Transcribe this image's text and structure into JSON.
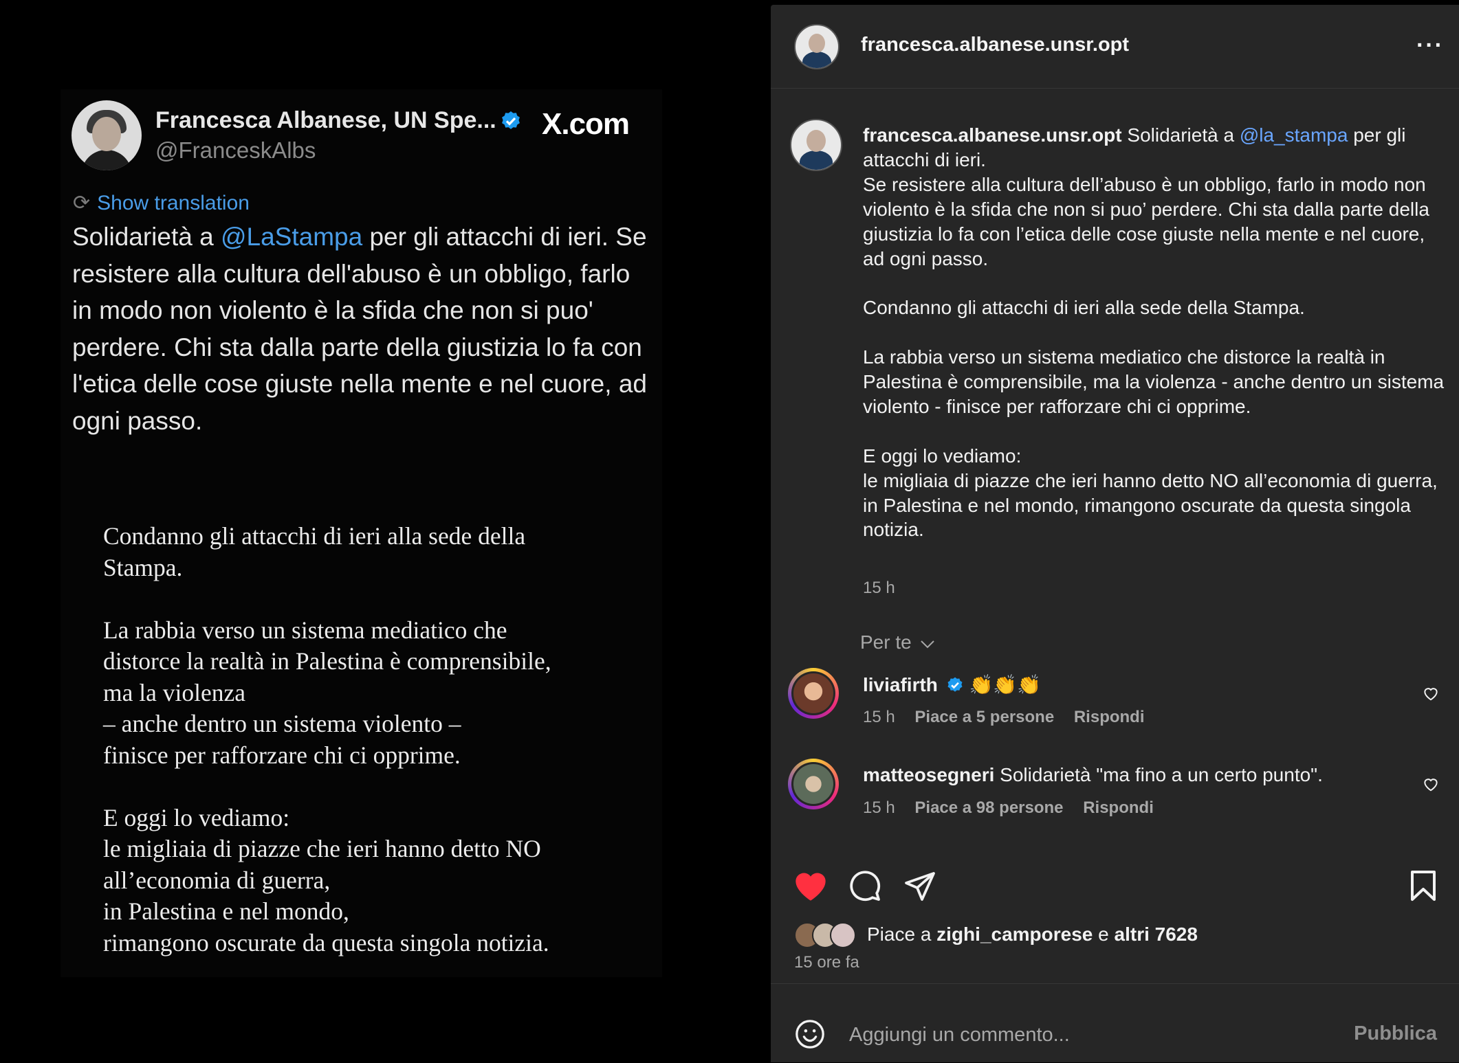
{
  "tweet": {
    "name": "Francesca Albanese, UN Spe...",
    "handle": "@FranceskAlbs",
    "site": "X.com",
    "show_translation": "Show translation",
    "text_before": "Solidarietà a ",
    "mention": "@LaStampa",
    "text_after": " per gli attacchi di ieri. Se resistere alla cultura dell'abuso è un obbligo, farlo in modo non violento è la sfida che non si puo' perdere. Chi sta dalla parte della giustizia lo fa con l'etica delle cose giuste nella mente e nel cuore, ad ogni passo.",
    "quote_text": "Condanno gli attacchi di ieri alla sede della\nStampa.\n\nLa rabbia verso un sistema mediatico che\ndistorce la realtà in Palestina è comprensibile,\nma la violenza\n– anche dentro un sistema violento –\nfinisce per rafforzare chi ci opprime.\n\nE oggi lo vediamo:\nle migliaia di piazze che ieri hanno detto NO\nall’economia di guerra,\nin Palestina e nel mondo,\nrimangono oscurate da questa singola notizia."
  },
  "ig": {
    "username": "francesca.albanese.unsr.opt",
    "more": "···",
    "caption": {
      "username": "francesca.albanese.unsr.opt",
      "before_mention": " Solidarietà a ",
      "mention": "@la_stampa",
      "after_mention": " per gli attacchi di ieri.",
      "p1": "Se resistere alla cultura dell’abuso è un obbligo, farlo in modo non violento è la sfida che non si puo’ perdere. Chi sta dalla parte della giustizia lo fa con l’etica delle cose giuste nella mente e nel cuore, ad ogni passo.",
      "p2": "Condanno gli attacchi di ieri alla sede della Stampa.",
      "p3": "La rabbia verso un sistema mediatico che distorce la realtà in Palestina è comprensibile, ma la violenza - anche dentro un sistema violento - finisce per rafforzare chi ci opprime.",
      "p4a": "E oggi lo vediamo:",
      "p4b": "le migliaia di piazze che ieri hanno detto NO all’economia di guerra, in Palestina e nel mondo, rimangono oscurate da questa singola notizia.",
      "time": "15 h"
    },
    "per_te": "Per te",
    "comments": [
      {
        "username": "liviafirth",
        "text": " 👏👏👏",
        "time": "15 h",
        "likes": "Piace a 5 persone",
        "reply": "Rispondi"
      },
      {
        "username": "matteosegneri",
        "text": " Solidarietà \"ma fino a un certo punto\".",
        "time": "15 h",
        "likes": "Piace a 98 persone",
        "reply": "Rispondi"
      }
    ],
    "likes": {
      "prefix": "Piace a ",
      "user": "zighi_camporese",
      "middle": " e ",
      "others": "altri 7628"
    },
    "posted_ago": "15 ore fa",
    "comment_placeholder": "Aggiungi un commento...",
    "publish": "Pubblica",
    "colors": {
      "heart_liked": "#ff3040",
      "link_blue": "#6aa6ff",
      "verified_blue": "#1d9bf0"
    }
  }
}
